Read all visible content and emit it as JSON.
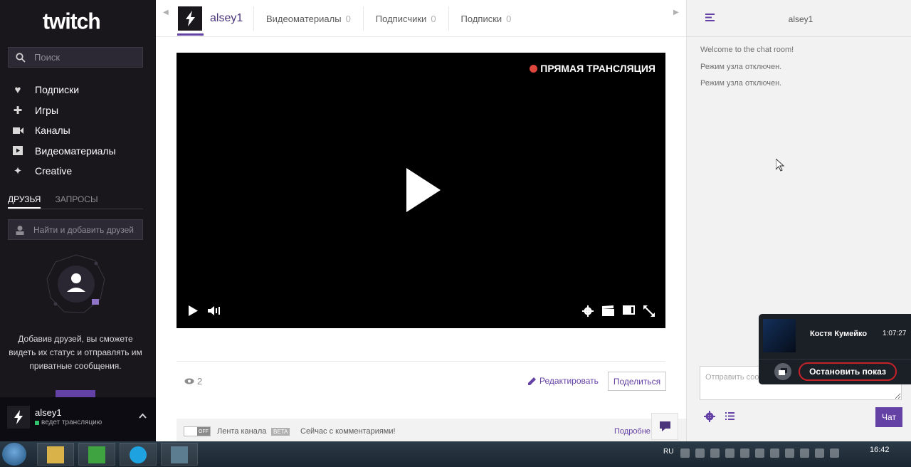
{
  "sidebar": {
    "logo": "twitch",
    "search_placeholder": "Поиск",
    "nav": [
      {
        "label": "Подписки",
        "icon": "heart-icon"
      },
      {
        "label": "Игры",
        "icon": "gamepad-icon"
      },
      {
        "label": "Каналы",
        "icon": "camera-icon"
      },
      {
        "label": "Видеоматериалы",
        "icon": "video-icon"
      },
      {
        "label": "Creative",
        "icon": "sparkle-icon"
      }
    ],
    "tabs": {
      "friends": "ДРУЗЬЯ",
      "requests": "ЗАПРОСЫ"
    },
    "friend_search_placeholder": "Найти и добавить друзей",
    "friends_message": "Добавив друзей, вы сможете видеть их статус и отправлять им приватные сообщения.",
    "user": {
      "name": "alsey1",
      "status": "ведет трансляцию"
    }
  },
  "channel": {
    "name": "alsey1",
    "tabs": [
      {
        "label": "Видеоматериалы",
        "count": "0"
      },
      {
        "label": "Подписчики",
        "count": "0"
      },
      {
        "label": "Подписки",
        "count": "0"
      }
    ],
    "live_label": "ПРЯМАЯ ТРАНСЛЯЦИЯ",
    "viewers": "2",
    "edit_label": "Редактировать",
    "share_label": "Поделиться",
    "feed": {
      "toggle": "OFF",
      "label": "Лента канала",
      "beta": "BETA",
      "now": "Сейчас с комментариями!",
      "more": "Подробне"
    }
  },
  "chat": {
    "title": "alsey1",
    "messages": [
      "Welcome to the chat room!",
      "Режим узла отключен.",
      "Режим узла отключен."
    ],
    "input_placeholder": "Отправить сообщение",
    "send_label": "Чат"
  },
  "overlay": {
    "name": "Костя Кумейко",
    "time": "1:07:27",
    "stop_label": "Остановить показ"
  },
  "taskbar": {
    "lang": "RU",
    "clock": "16:42"
  },
  "colors": {
    "brand": "#6441a4",
    "sidebar": "#19171c",
    "live": "#e0463b",
    "stop": "#c7212a"
  }
}
